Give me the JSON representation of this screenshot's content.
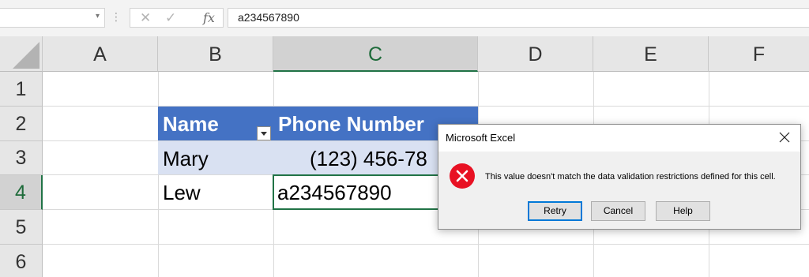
{
  "formula_bar": {
    "name_box": "",
    "cancel_icon": "close-icon",
    "enter_icon": "checkmark-icon",
    "fx_label": "fx",
    "content": "a234567890"
  },
  "columns": [
    "A",
    "B",
    "C",
    "D",
    "E",
    "F"
  ],
  "selected_column": "C",
  "rows": [
    "1",
    "2",
    "3",
    "4",
    "5",
    "6"
  ],
  "selected_row": "4",
  "table": {
    "headers": [
      "Name",
      "Phone Number"
    ],
    "rows": [
      [
        "Mary",
        "(123) 456-78"
      ],
      [
        "Lew",
        "a234567890"
      ]
    ]
  },
  "dialog": {
    "title": "Microsoft Excel",
    "message": "This value doesn't match the data validation restrictions defined for this cell.",
    "icon": "error-icon",
    "buttons": {
      "retry": "Retry",
      "cancel": "Cancel",
      "help": "Help"
    }
  },
  "colors": {
    "table_header": "#4472c4",
    "table_band": "#d9e1f2",
    "selection_green": "#217346",
    "error_red": "#e81123"
  }
}
